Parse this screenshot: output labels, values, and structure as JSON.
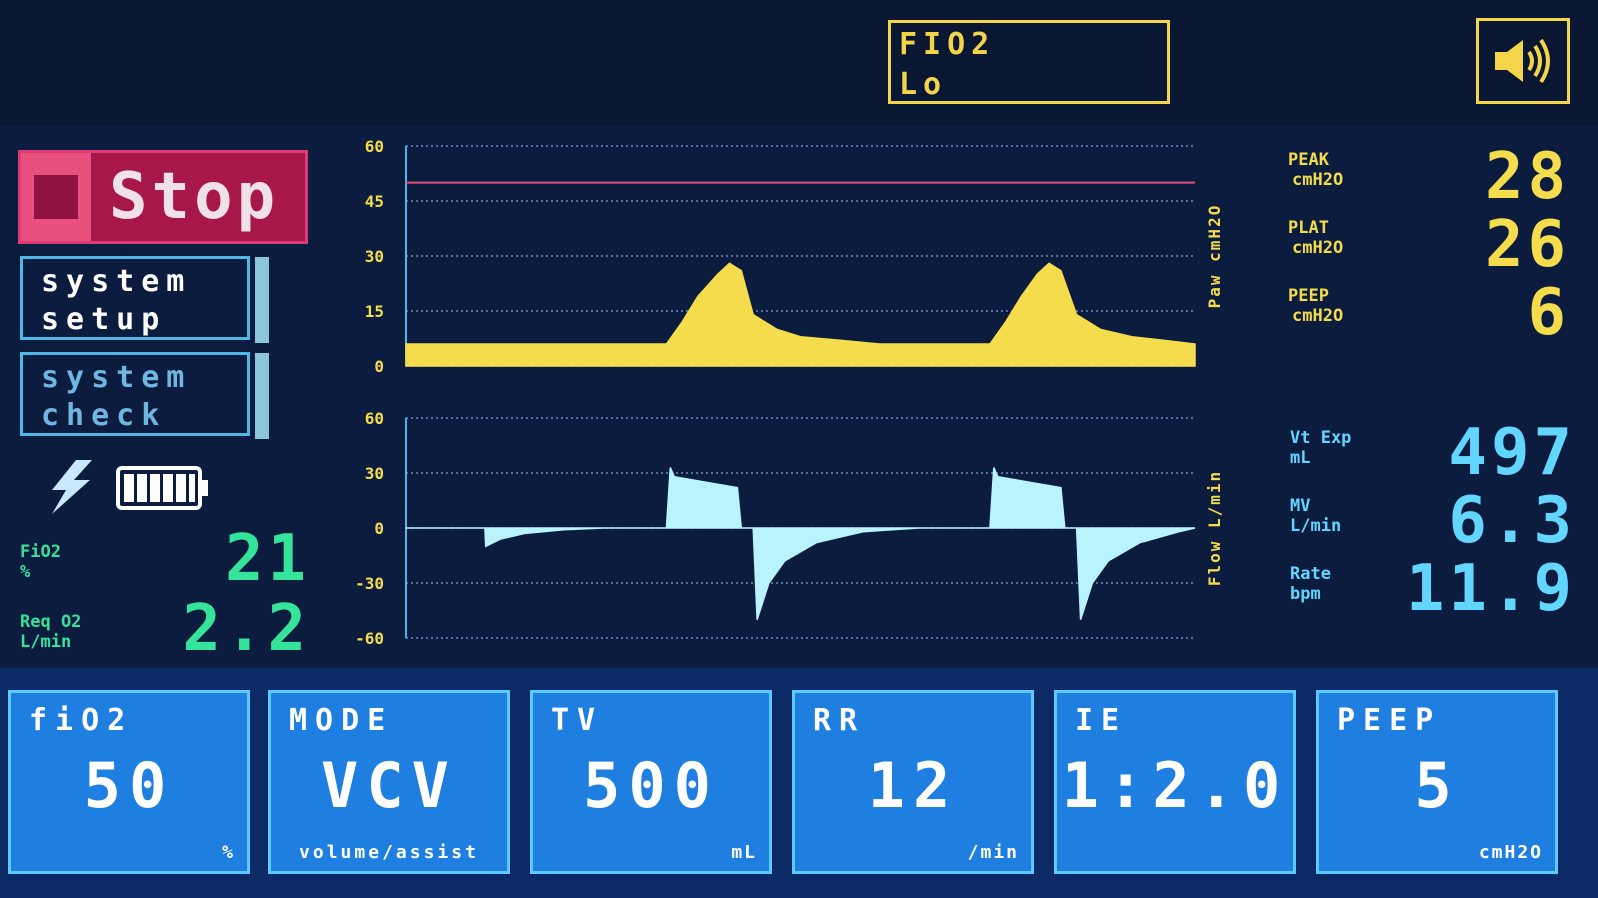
{
  "alarm": {
    "line1": "FIO2",
    "line2": "Lo"
  },
  "speaker_icon": "speaker-volume-icon",
  "controls": {
    "stop_label": "Stop",
    "setup_line1": "system",
    "setup_line2": "setup",
    "check_line1": "system",
    "check_line2": "check"
  },
  "status": {
    "power_icon": "lightning-icon",
    "battery_icon": "battery-icon"
  },
  "left_readings": {
    "fio2_label": "FiO2",
    "fio2_unit": "%",
    "fio2_value": "21",
    "reqo2_label": "Req O2",
    "reqo2_unit": "L/min",
    "reqo2_value": "2.2"
  },
  "right_readings": {
    "peak_label": "PEAK",
    "peak_unit": "cmH2O",
    "peak_value": "28",
    "plat_label": "PLAT",
    "plat_unit": "cmH2O",
    "plat_value": "26",
    "peep_label": "PEEP",
    "peep_unit": "cmH2O",
    "peep_value": "6",
    "vt_label": "Vt Exp",
    "vt_unit": "mL",
    "vt_value": "497",
    "mv_label": "MV",
    "mv_unit": "L/min",
    "mv_value": "6.3",
    "rate_label": "Rate",
    "rate_unit": "bpm",
    "rate_value": "11.9"
  },
  "chart_data": [
    {
      "type": "area",
      "ylabel": "Paw cmH2O",
      "ylim": [
        0,
        60
      ],
      "yticks": [
        "60",
        "45",
        "30",
        "15",
        "0"
      ],
      "alarm_line": 50,
      "color": "#f5dc4c",
      "x": [
        0,
        0.1,
        0.33,
        0.35,
        0.37,
        0.395,
        0.41,
        0.425,
        0.44,
        0.47,
        0.5,
        0.55,
        0.6,
        0.65,
        0.74,
        0.76,
        0.78,
        0.8,
        0.815,
        0.83,
        0.85,
        0.88,
        0.92,
        0.96,
        1.0
      ],
      "values": [
        6,
        6,
        6,
        12,
        19,
        25,
        28,
        26,
        14,
        10,
        8,
        7,
        6,
        6,
        6,
        12,
        19,
        25,
        28,
        26,
        14,
        10,
        8,
        7,
        6
      ]
    },
    {
      "type": "area",
      "ylabel": "Flow L/min",
      "ylim": [
        -60,
        60
      ],
      "yticks": [
        "60",
        "30",
        "0",
        "-30",
        "-60"
      ],
      "color": "#b8f3ff",
      "x": [
        0,
        0.1,
        0.101,
        0.12,
        0.15,
        0.2,
        0.25,
        0.33,
        0.335,
        0.34,
        0.42,
        0.425,
        0.44,
        0.445,
        0.46,
        0.48,
        0.52,
        0.58,
        0.65,
        0.74,
        0.745,
        0.75,
        0.83,
        0.835,
        0.85,
        0.855,
        0.87,
        0.89,
        0.93,
        0.98,
        1.0
      ],
      "values": [
        0,
        0,
        -10,
        -6,
        -3,
        -1,
        0,
        0,
        33,
        28,
        22,
        0,
        0,
        -50,
        -30,
        -18,
        -8,
        -2,
        0,
        0,
        33,
        28,
        22,
        0,
        0,
        -50,
        -30,
        -18,
        -8,
        -2,
        0
      ]
    }
  ],
  "settings": [
    {
      "label": "fiO2",
      "value": "50",
      "unit": "%"
    },
    {
      "label": "MODE",
      "value": "VCV",
      "unit": "volume/assist"
    },
    {
      "label": "TV",
      "value": "500",
      "unit": "mL"
    },
    {
      "label": "RR",
      "value": "12",
      "unit": "/min"
    },
    {
      "label": "IE",
      "value": "1:2.0",
      "unit": ""
    },
    {
      "label": "PEEP",
      "value": "5",
      "unit": "cmH2O"
    }
  ],
  "colors": {
    "alarm": "#f4d54a",
    "stop": "#a8174a",
    "setting_bg": "#1f7fe0",
    "green_readout": "#36e39a",
    "yellow_readout": "#f5dc4c",
    "cyan_readout": "#62d6ff"
  }
}
